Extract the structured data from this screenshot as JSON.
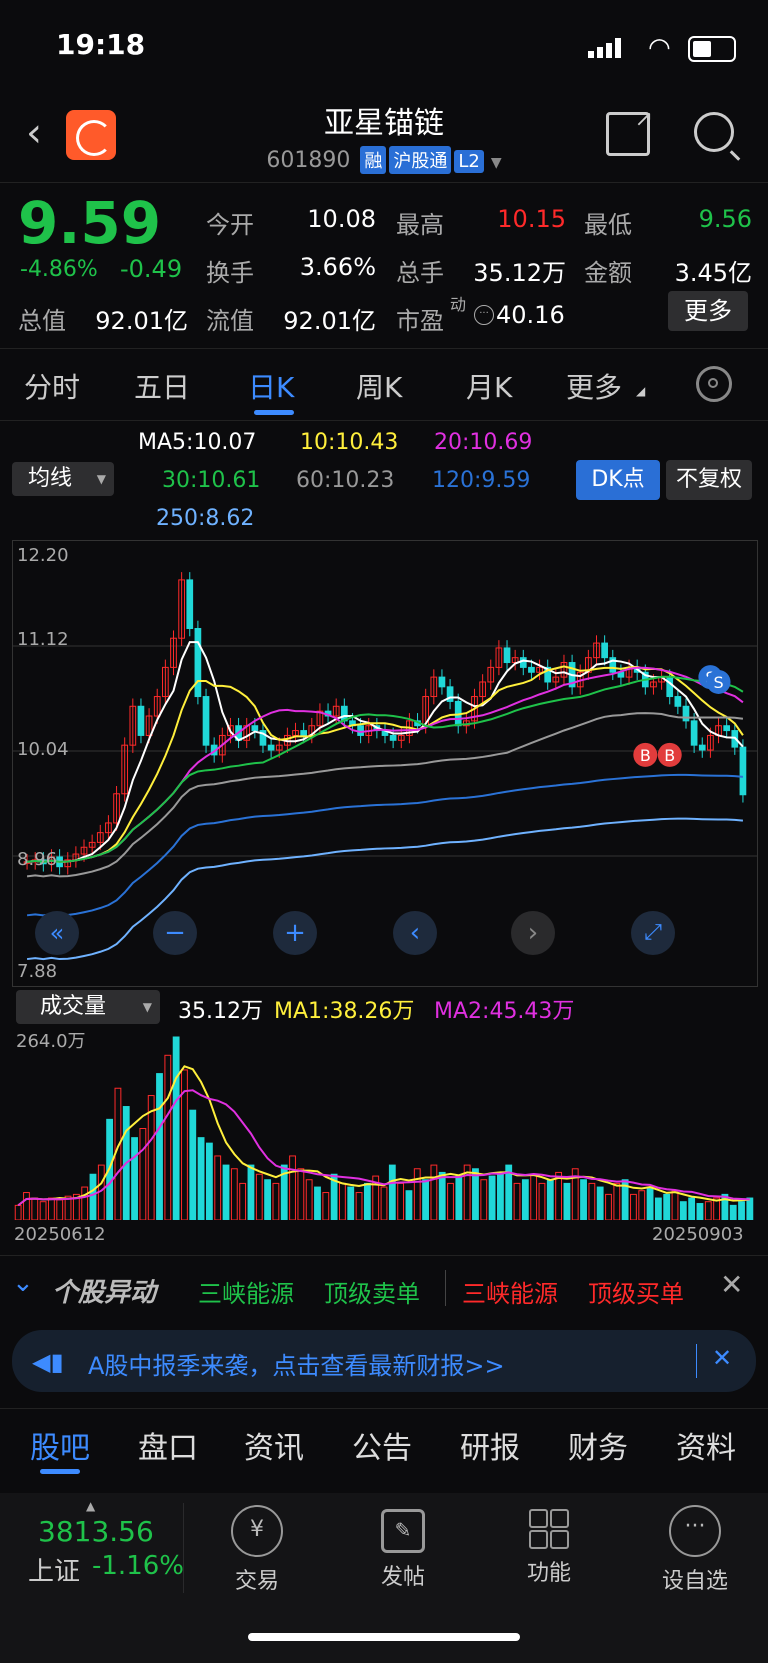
{
  "status": {
    "time": "19:18"
  },
  "header": {
    "name": "亚星锚链",
    "code": "601890",
    "tags": [
      "融",
      "沪股通",
      "L2"
    ]
  },
  "quote": {
    "price": "9.59",
    "pct": "-4.86%",
    "chg": "-0.49",
    "open_label": "今开",
    "open": "10.08",
    "high_label": "最高",
    "high": "10.15",
    "low_label": "最低",
    "low": "9.56",
    "turnover_label": "换手",
    "turnover": "3.66%",
    "vol_label": "总手",
    "vol": "35.12万",
    "amount_label": "金额",
    "amount": "3.45亿",
    "mcap_label": "总值",
    "mcap": "92.01亿",
    "float_label": "流值",
    "float": "92.01亿",
    "pe_label": "市盈",
    "pe_sup": "动",
    "pe": "40.16",
    "more": "更多"
  },
  "tabs": [
    "分时",
    "五日",
    "日K",
    "周K",
    "月K",
    "更多"
  ],
  "ma": {
    "dropdown": "均线",
    "ma5": "MA5:10.07",
    "ma10": "10:10.43",
    "ma20": "20:10.69",
    "ma30": "30:10.61",
    "ma60": "60:10.23",
    "ma120": "120:9.59",
    "ma250": "250:8.62",
    "dk": "DK点",
    "fq": "不复权"
  },
  "chart_data": {
    "type": "candlestick",
    "y_ticks": [
      "12.20",
      "11.12",
      "10.04",
      "8.96",
      "7.88"
    ],
    "ylim": [
      7.88,
      12.2
    ],
    "x_start": "20250612",
    "x_end": "20250903",
    "markers": [
      "B",
      "B",
      "S",
      "S"
    ],
    "closes": [
      8.9,
      8.92,
      8.88,
      8.95,
      8.85,
      8.92,
      8.98,
      9.05,
      9.1,
      9.2,
      9.3,
      9.6,
      10.1,
      10.5,
      10.2,
      10.4,
      10.6,
      10.9,
      11.2,
      11.8,
      11.3,
      10.6,
      10.1,
      10.0,
      10.2,
      10.3,
      10.15,
      10.3,
      10.25,
      10.1,
      10.05,
      10.1,
      10.2,
      10.25,
      10.2,
      10.3,
      10.45,
      10.4,
      10.5,
      10.35,
      10.3,
      10.2,
      10.3,
      10.25,
      10.2,
      10.15,
      10.2,
      10.35,
      10.3,
      10.6,
      10.8,
      10.7,
      10.55,
      10.3,
      10.35,
      10.6,
      10.75,
      10.9,
      11.1,
      10.95,
      11.0,
      10.9,
      10.85,
      10.9,
      10.75,
      10.8,
      10.95,
      10.7,
      10.85,
      11.0,
      11.15,
      11.0,
      10.85,
      10.8,
      10.9,
      10.85,
      10.7,
      10.75,
      10.8,
      10.6,
      10.5,
      10.35,
      10.1,
      10.05,
      10.2,
      10.3,
      10.25,
      10.08,
      9.59
    ]
  },
  "volume": {
    "dropdown": "成交量",
    "value": "35.12万",
    "ma1": "MA1:38.26万",
    "ma2": "MA2:45.43万",
    "max": "264.0万",
    "bars": [
      0.08,
      0.15,
      0.12,
      0.1,
      0.12,
      0.11,
      0.13,
      0.14,
      0.18,
      0.25,
      0.3,
      0.55,
      0.72,
      0.62,
      0.45,
      0.5,
      0.68,
      0.8,
      0.9,
      1.0,
      0.82,
      0.6,
      0.45,
      0.42,
      0.35,
      0.3,
      0.28,
      0.2,
      0.3,
      0.25,
      0.22,
      0.2,
      0.3,
      0.35,
      0.28,
      0.22,
      0.18,
      0.15,
      0.25,
      0.2,
      0.18,
      0.15,
      0.2,
      0.24,
      0.18,
      0.3,
      0.2,
      0.16,
      0.28,
      0.22,
      0.3,
      0.26,
      0.2,
      0.24,
      0.3,
      0.28,
      0.22,
      0.24,
      0.26,
      0.3,
      0.2,
      0.22,
      0.25,
      0.2,
      0.22,
      0.26,
      0.2,
      0.28,
      0.22,
      0.2,
      0.18,
      0.14,
      0.2,
      0.22,
      0.14,
      0.16,
      0.18,
      0.12,
      0.14,
      0.16,
      0.1,
      0.12,
      0.09,
      0.1,
      0.12,
      0.14,
      0.08,
      0.1,
      0.12
    ],
    "colors": "rrrrrrrrrcrcrccrrcrcrcccrcrrcrcrcrrrcrcrcrcrrcrcrcrcrcrcrcccrcrrcrcrcrcrrcrrcccrcccrrcccccc"
  },
  "ticker": {
    "title": "个股异动",
    "items": [
      "三峡能源",
      "顶级卖单",
      "三峡能源",
      "顶级买单"
    ]
  },
  "banner": {
    "text": "A股中报季来袭，点击查看最新财报>>"
  },
  "bottom_tabs": [
    "股吧",
    "盘口",
    "资讯",
    "公告",
    "研报",
    "财务",
    "资料"
  ],
  "bottom_nav": {
    "index_value": "3813.56",
    "index_name": "上证",
    "index_pct": "-1.16%",
    "items": [
      "交易",
      "发帖",
      "功能",
      "设自选"
    ]
  },
  "colors": {
    "up": "#ff2a2a",
    "down": "#20d8d8",
    "ma5": "#ffffff",
    "ma10": "#ffef3c",
    "ma20": "#e030e0",
    "ma30": "#1fc24a",
    "ma60": "#999999",
    "ma120": "#2a72d6",
    "ma250": "#6fb2ff"
  }
}
